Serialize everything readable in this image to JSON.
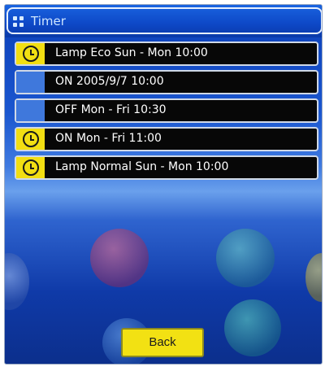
{
  "window": {
    "title": "Timer"
  },
  "timers": [
    {
      "label": "Lamp Eco Sun - Mon 10:00",
      "badge": "yellow",
      "icon": "clock-icon"
    },
    {
      "label": "ON 2005/9/7 10:00",
      "badge": "blue",
      "icon": ""
    },
    {
      "label": "OFF Mon - Fri 10:30",
      "badge": "blue",
      "icon": ""
    },
    {
      "label": "ON Mon - Fri 11:00",
      "badge": "yellow",
      "icon": "clock-icon"
    },
    {
      "label": "Lamp Normal Sun - Mon 10:00",
      "badge": "yellow",
      "icon": "clock-icon"
    }
  ],
  "back_button": {
    "label": "Back"
  },
  "colors": {
    "accent_yellow": "#f2de12",
    "badge_blue": "#3f78dc",
    "row_bg": "#070707"
  }
}
